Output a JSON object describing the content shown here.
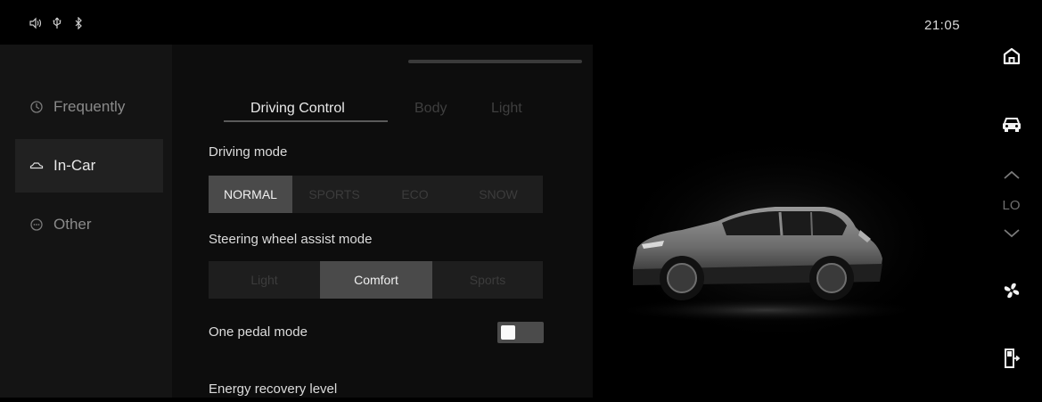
{
  "status_bar": {
    "icons": [
      "volume-icon",
      "usb-icon",
      "bluetooth-icon"
    ],
    "time": "21:05"
  },
  "sidebar": {
    "items": [
      {
        "label": "Frequently",
        "icon": "frequently-icon",
        "active": false
      },
      {
        "label": "In-Car",
        "icon": "car-outline-icon",
        "active": true
      },
      {
        "label": "Other",
        "icon": "other-icon",
        "active": false
      }
    ]
  },
  "tabs": [
    {
      "label": "Driving Control",
      "active": true
    },
    {
      "label": "Body",
      "active": false
    },
    {
      "label": "Light",
      "active": false
    }
  ],
  "driving_mode": {
    "label": "Driving mode",
    "options": [
      "NORMAL",
      "SPORTS",
      "ECO",
      "SNOW"
    ],
    "selected": "NORMAL"
  },
  "steering_mode": {
    "label": "Steering wheel assist mode",
    "options": [
      "Light",
      "Comfort",
      "Sports"
    ],
    "selected": "Comfort"
  },
  "one_pedal": {
    "label": "One pedal mode",
    "enabled": false
  },
  "energy_recovery": {
    "label": "Energy recovery level"
  },
  "right_rail": {
    "icons": [
      "home-icon",
      "car-icon",
      "chevron-up-icon",
      "chevron-down-icon",
      "fan-icon",
      "seat-icon"
    ],
    "fan_level": "LO"
  },
  "colors": {
    "background": "#000000",
    "panel": "#0d0d0d",
    "sidebar": "#141414",
    "active_segment": "#4a4a4a",
    "text_primary": "#e8e8e8",
    "text_dim": "#3f3f3f"
  }
}
